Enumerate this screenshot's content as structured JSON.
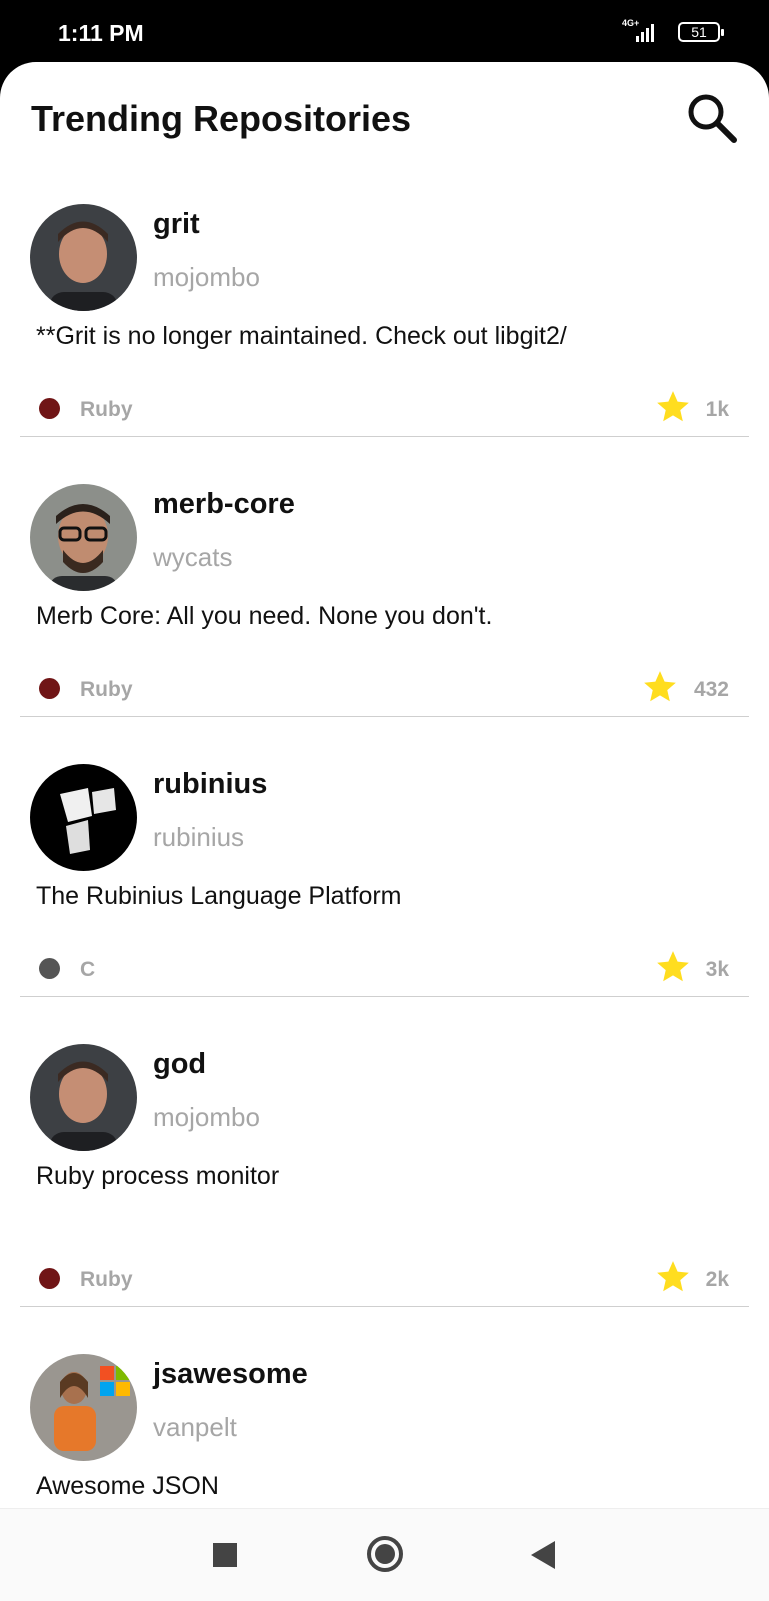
{
  "status_bar": {
    "time": "1:11 PM",
    "network": "4G+",
    "battery": "51",
    "icons": [
      "signal-icon",
      "battery-icon"
    ]
  },
  "header": {
    "title": "Trending Repositories",
    "search_icon": "search-icon"
  },
  "repos": [
    {
      "name": "grit",
      "owner": "mojombo",
      "description": "**Grit is no longer maintained. Check out libgit2/",
      "language": "Ruby",
      "language_color": "#701516",
      "stars": "1k"
    },
    {
      "name": "merb-core",
      "owner": "wycats",
      "description": "Merb Core: All you need. None you don't.",
      "language": "Ruby",
      "language_color": "#701516",
      "stars": "432"
    },
    {
      "name": "rubinius",
      "owner": "rubinius",
      "description": "The Rubinius Language Platform",
      "language": "C",
      "language_color": "#555555",
      "stars": "3k"
    },
    {
      "name": "god",
      "owner": "mojombo",
      "description": "Ruby process monitor",
      "language": "Ruby",
      "language_color": "#701516",
      "stars": "2k"
    },
    {
      "name": "jsawesome",
      "owner": "vanpelt",
      "description": "Awesome JSON",
      "language": "",
      "language_color": "",
      "stars": ""
    }
  ],
  "colors": {
    "star": "#FFDD1F",
    "muted_text": "#A6A6A6",
    "divider": "#CFCFCF"
  },
  "navbar": {
    "icons": [
      "recents-square-icon",
      "home-circle-icon",
      "back-triangle-icon"
    ]
  }
}
